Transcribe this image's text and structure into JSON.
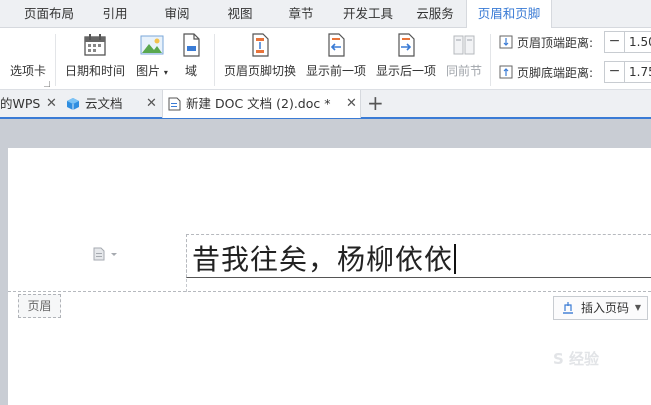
{
  "menubar": {
    "tabs": [
      "页面布局",
      "引用",
      "审阅",
      "视图",
      "章节",
      "开发工具",
      "云服务",
      "页眉和页脚"
    ],
    "active_tab": "页眉和页脚"
  },
  "ribbon": {
    "partial_label": "选项卡",
    "buttons": [
      {
        "label": "日期和时间",
        "icon": "calendar-icon"
      },
      {
        "label": "图片",
        "icon": "picture-icon"
      },
      {
        "label": "域",
        "icon": "field-icon"
      },
      {
        "label": "页眉页脚切换",
        "icon": "header-footer-switch-icon"
      },
      {
        "label": "显示前一项",
        "icon": "show-previous-icon"
      },
      {
        "label": "显示后一项",
        "icon": "show-next-icon"
      },
      {
        "label": "同前节",
        "icon": "same-as-previous-icon"
      }
    ],
    "header_top_distance": {
      "label": "页眉顶端距离:",
      "value": "1.50"
    },
    "footer_bottom_distance": {
      "label": "页脚底端距离:",
      "value": "1.75"
    }
  },
  "doc_tabs": {
    "tabs": [
      {
        "label": "的WPS"
      },
      {
        "label": "云文档"
      },
      {
        "label": "新建 DOC 文档 (2).doc *"
      }
    ],
    "new_tab": "+"
  },
  "document": {
    "header_text": "昔我往矣，杨柳依依",
    "header_label": "页眉",
    "insert_page_number": "插入页码",
    "watermark": "S 经验"
  },
  "colors": {
    "accent": "#3a7bd5",
    "ribbon_bg": "#ffffff",
    "workspace_bg": "#c9cdd4"
  }
}
